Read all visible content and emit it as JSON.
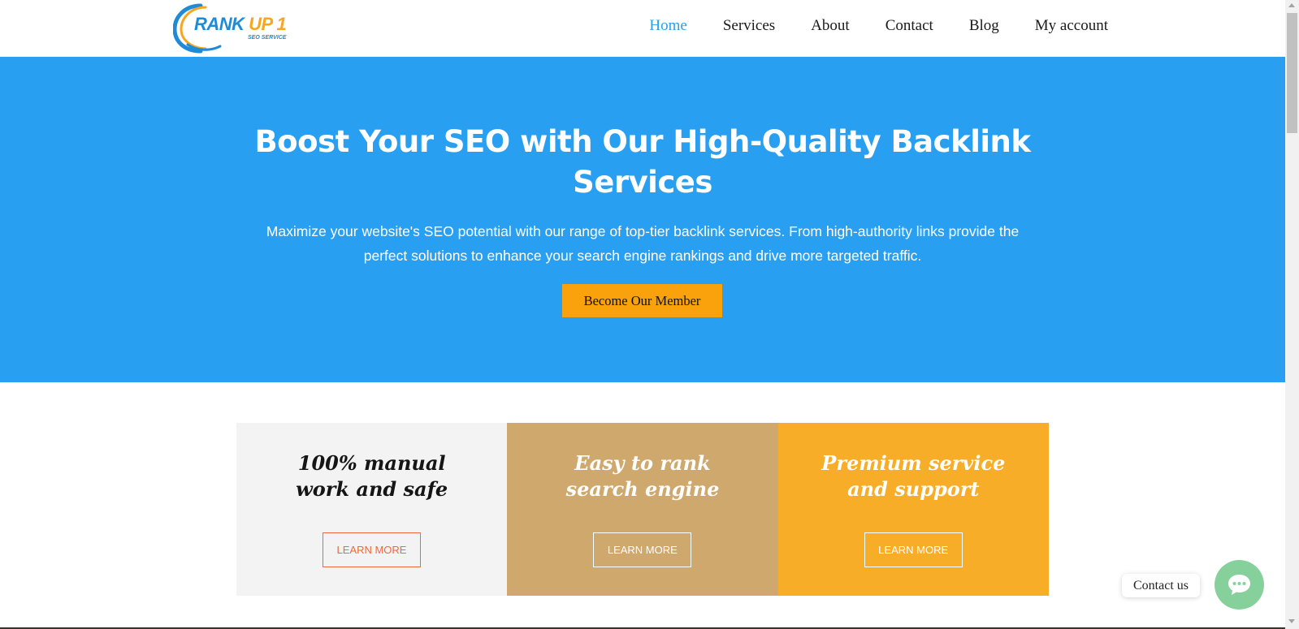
{
  "header": {
    "logo": {
      "text_main": "RANK ",
      "text_up": "UP 1",
      "text_sub": "SEO SERVICE",
      "colors": {
        "blue": "#1f8ad6",
        "orange": "#f5a623"
      }
    },
    "nav": [
      {
        "label": "Home",
        "active": true
      },
      {
        "label": "Services",
        "active": false
      },
      {
        "label": "About",
        "active": false
      },
      {
        "label": "Contact",
        "active": false
      },
      {
        "label": "Blog",
        "active": false
      },
      {
        "label": "My account",
        "active": false
      }
    ]
  },
  "hero": {
    "title": "Boost Your SEO with Our High-Quality Backlink Services",
    "description": "Maximize your website's SEO potential with our range of top-tier backlink services. From high-authority links provide the perfect solutions to enhance your search engine rankings and drive more targeted traffic.",
    "cta_label": "Become Our Member",
    "background_color": "#299ff2",
    "cta_color": "#f9a20c"
  },
  "features": [
    {
      "title": "100% manual work and safe",
      "button_label": "LEARN MORE",
      "background_color": "#f3f3f3"
    },
    {
      "title": "Easy to rank search engine",
      "button_label": "LEARN MORE",
      "background_color": "#cfa86d"
    },
    {
      "title": "Premium service and support",
      "button_label": "LEARN MORE",
      "background_color": "#f7ad28"
    }
  ],
  "contact_widget": {
    "label": "Contact us",
    "icon": "chat-bubble-icon",
    "color": "#86d19b"
  }
}
